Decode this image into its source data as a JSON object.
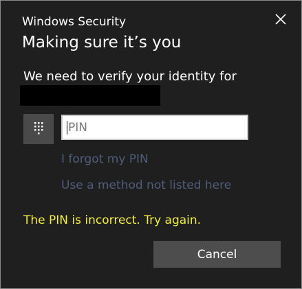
{
  "dialog": {
    "app_title": "Windows Security",
    "heading": "Making sure it’s you",
    "message": "We need to verify your identity for",
    "pin_field": {
      "placeholder": "PIN",
      "value": ""
    },
    "links": {
      "forgot_pin": "I forgot my PIN",
      "other_method": "Use a method not listed here"
    },
    "error_text": "The PIN is incorrect. Try again.",
    "cancel_label": "Cancel",
    "icons": {
      "close": "close-icon",
      "keypad": "keypad-icon"
    },
    "colors": {
      "background": "#1f1f1f",
      "error": "#f2ef3c",
      "link": "#4f5d7a",
      "button": "#4d4d4d"
    }
  }
}
